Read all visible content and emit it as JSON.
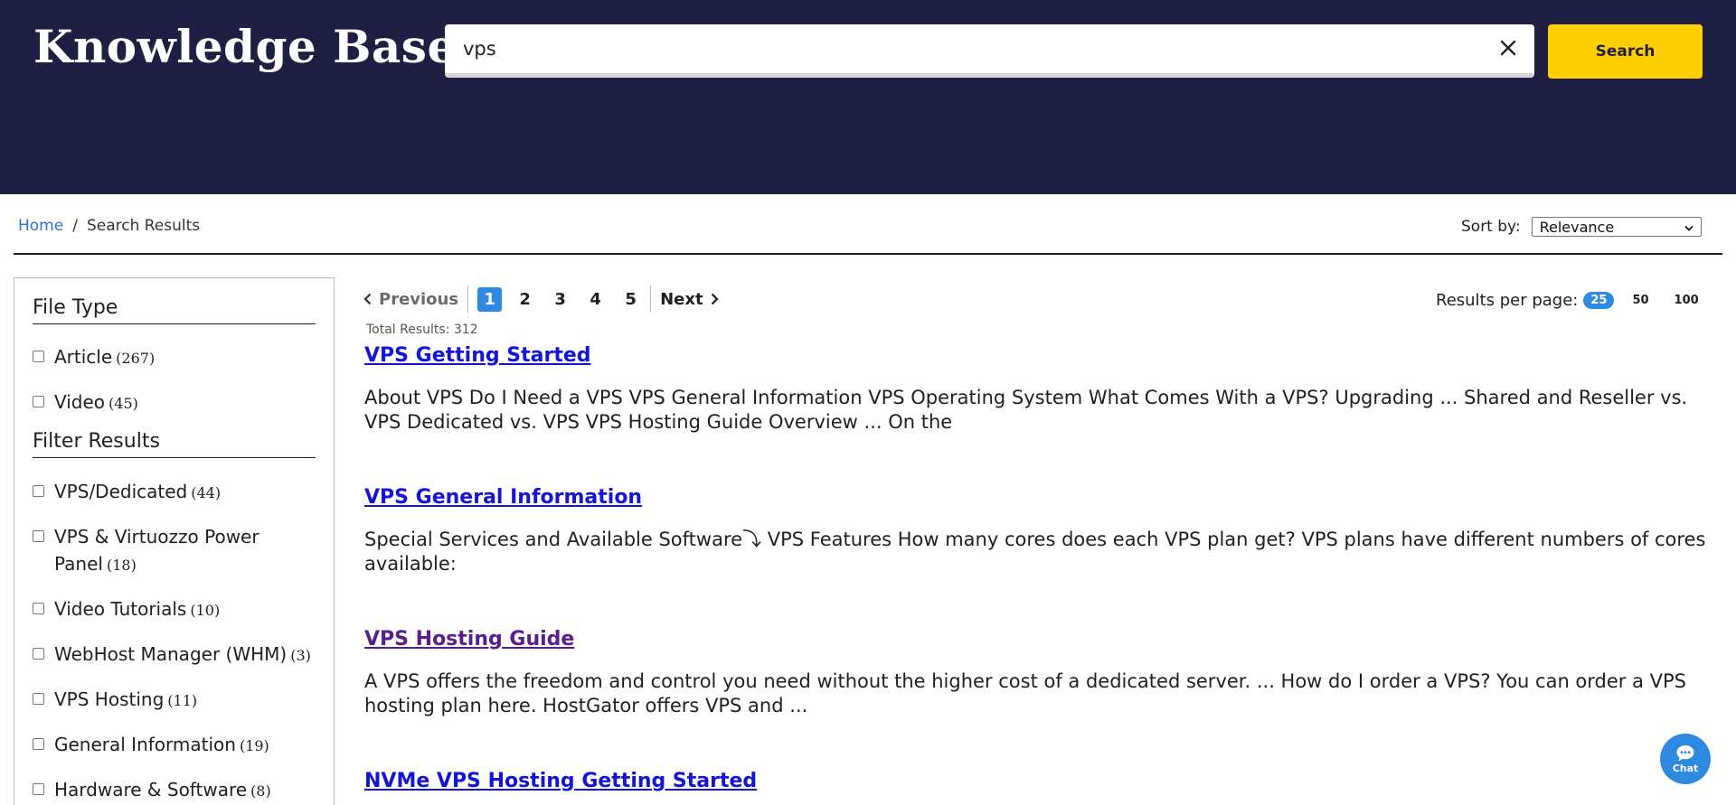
{
  "header": {
    "title": "Knowledge Base",
    "search_value": "vps",
    "search_button": "Search"
  },
  "breadcrumb": {
    "home": "Home",
    "separator": "/",
    "current": "Search Results"
  },
  "sort": {
    "label": "Sort by:",
    "selected": "Relevance"
  },
  "sidebar": {
    "file_type_heading": "File Type",
    "file_types": [
      {
        "label": "Article",
        "count": "(267)"
      },
      {
        "label": "Video",
        "count": "(45)"
      }
    ],
    "filter_heading": "Filter Results",
    "filters": [
      {
        "label": "VPS/Dedicated",
        "count": "(44)"
      },
      {
        "label": "VPS & Virtuozzo Power Panel",
        "count": "(18)"
      },
      {
        "label": "Video Tutorials",
        "count": "(10)"
      },
      {
        "label": "WebHost Manager (WHM)",
        "count": "(3)"
      },
      {
        "label": "VPS Hosting",
        "count": "(11)"
      },
      {
        "label": "General Information",
        "count": "(19)"
      },
      {
        "label": "Hardware & Software",
        "count": "(8)"
      }
    ]
  },
  "pagination": {
    "previous": "Previous",
    "pages": [
      "1",
      "2",
      "3",
      "4",
      "5"
    ],
    "current_page": "1",
    "next": "Next",
    "total": "Total Results: 312"
  },
  "results_per_page": {
    "label": "Results per page:",
    "options": [
      "25",
      "50",
      "100"
    ],
    "selected": "25"
  },
  "results": [
    {
      "title": "VPS Getting Started",
      "snippet": "About VPS Do I Need a VPS VPS General Information VPS Operating System What Comes With a VPS? Upgrading ... Shared and Reseller vs. VPS Dedicated vs. VPS VPS Hosting Guide Overview ... On the"
    },
    {
      "title": "VPS General Information",
      "snippet": "Special Services and Available Software⤵ VPS Features How many cores does each VPS plan get? VPS plans have different numbers of cores available:"
    },
    {
      "title": "VPS Hosting Guide",
      "snippet": "A VPS offers the freedom and control you need without the higher cost of a dedicated server. ... How do I order a VPS? You can order a VPS hosting plan here. HostGator offers VPS and ..."
    },
    {
      "title": "NVMe VPS Hosting Getting Started",
      "snippet": ""
    }
  ],
  "chat": {
    "label": "Chat"
  },
  "colors": {
    "header_bg": "#1f1f43",
    "search_button": "#ffcf00",
    "accent_blue": "#2d8ae0",
    "link": "#1414d8",
    "visited_link": "#5a1e8c"
  }
}
